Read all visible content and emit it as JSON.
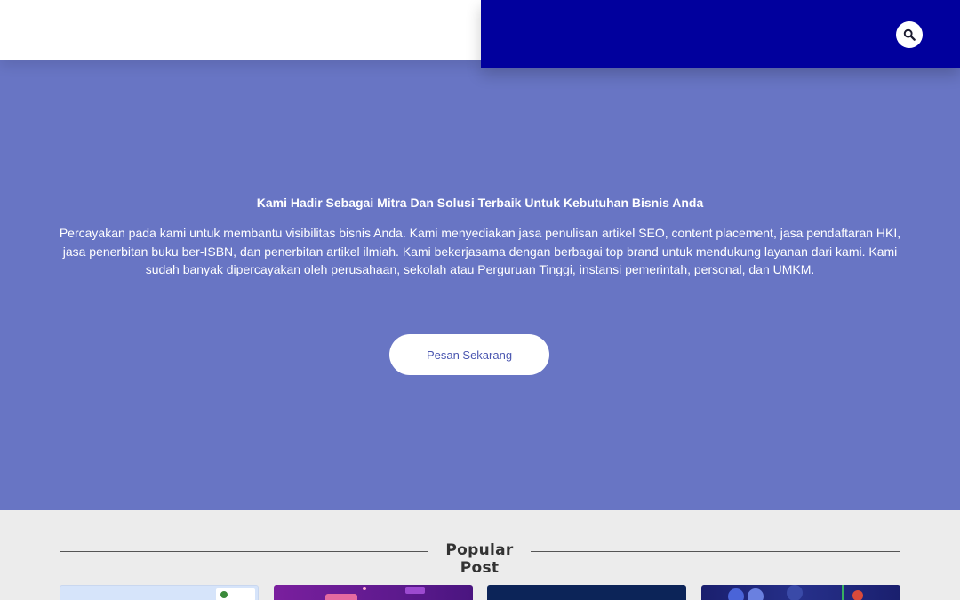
{
  "header": {
    "search_icon": "search-icon",
    "colors": {
      "left_bar": "#ffffff",
      "right_bar": "#01009d"
    }
  },
  "hero": {
    "title": "Kami Hadir Sebagai Mitra Dan Solusi Terbaik Untuk Kebutuhan Bisnis Anda",
    "description": "Percayakan pada kami untuk membantu visibilitas bisnis Anda. Kami menyediakan jasa penulisan artikel SEO, content placement, jasa pendaftaran HKI, jasa penerbitan buku ber-ISBN, dan penerbitan artikel ilmiah. Kami bekerjasama dengan berbagai top brand untuk mendukung layanan dari kami. Kami sudah banyak dipercayakan oleh perusahaan, sekolah atau Perguruan Tinggi, instansi pemerintah, personal, dan UMKM.",
    "cta_label": "Pesan Sekarang",
    "background": "#6875c4"
  },
  "popular": {
    "heading": "Popular Post",
    "posts_count_visible": 4
  }
}
